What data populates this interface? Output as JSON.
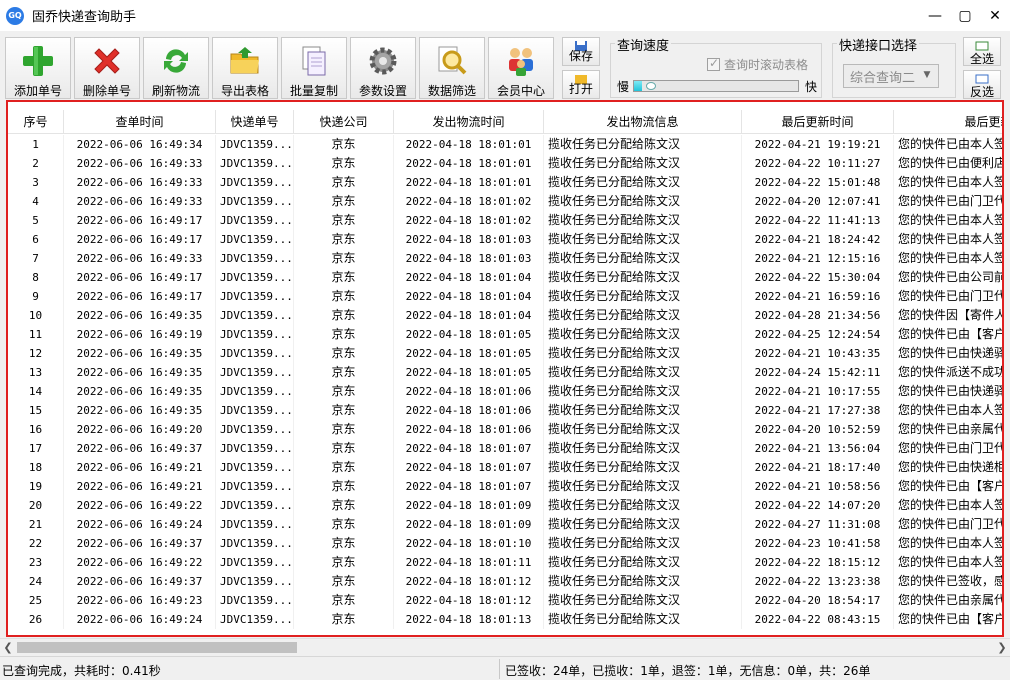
{
  "window": {
    "title": "固乔快递查询助手",
    "icon_text": "GQ"
  },
  "toolbar": {
    "buttons": [
      {
        "label": "添加单号",
        "icon": "plus-icon"
      },
      {
        "label": "删除单号",
        "icon": "delete-x-icon"
      },
      {
        "label": "刷新物流",
        "icon": "refresh-icon"
      },
      {
        "label": "导出表格",
        "icon": "folder-export-icon"
      },
      {
        "label": "批量复制",
        "icon": "copy-icon"
      },
      {
        "label": "参数设置",
        "icon": "gear-icon"
      },
      {
        "label": "数据筛选",
        "icon": "search-filter-icon"
      },
      {
        "label": "会员中心",
        "icon": "users-icon"
      }
    ],
    "save_label": "保存",
    "open_label": "打开",
    "speed_group_title": "查询速度",
    "scroll_checkbox_label": "查询时滚动表格",
    "scroll_checkbox_checked": true,
    "speed_slow": "慢",
    "speed_fast": "快",
    "speed_level": 0.05,
    "api_group_title": "快递接口选择",
    "api_selected": "综合查询二",
    "select_all_label": "全选",
    "invert_label": "反选"
  },
  "grid": {
    "columns": [
      "序号",
      "查单时间",
      "快递单号",
      "快递公司",
      "发出物流时间",
      "发出物流信息",
      "最后更新时间",
      "最后更新物流"
    ],
    "rows": [
      [
        "1",
        "2022-06-06 16:49:34",
        "JDVC1359...",
        "京东",
        "2022-04-18 18:01:01",
        "揽收任务已分配给陈文汉",
        "2022-04-21 19:19:21",
        "您的快件已由本人签"
      ],
      [
        "2",
        "2022-06-06 16:49:33",
        "JDVC1359...",
        "京东",
        "2022-04-18 18:01:01",
        "揽收任务已分配给陈文汉",
        "2022-04-22 10:11:27",
        "您的快件已由便利店"
      ],
      [
        "3",
        "2022-06-06 16:49:33",
        "JDVC1359...",
        "京东",
        "2022-04-18 18:01:01",
        "揽收任务已分配给陈文汉",
        "2022-04-22 15:01:48",
        "您的快件已由本人签"
      ],
      [
        "4",
        "2022-06-06 16:49:33",
        "JDVC1359...",
        "京东",
        "2022-04-18 18:01:02",
        "揽收任务已分配给陈文汉",
        "2022-04-20 12:07:41",
        "您的快件已由门卫代"
      ],
      [
        "5",
        "2022-06-06 16:49:17",
        "JDVC1359...",
        "京东",
        "2022-04-18 18:01:02",
        "揽收任务已分配给陈文汉",
        "2022-04-22 11:41:13",
        "您的快件已由本人签"
      ],
      [
        "6",
        "2022-06-06 16:49:17",
        "JDVC1359...",
        "京东",
        "2022-04-18 18:01:03",
        "揽收任务已分配给陈文汉",
        "2022-04-21 18:24:42",
        "您的快件已由本人签"
      ],
      [
        "7",
        "2022-06-06 16:49:33",
        "JDVC1359...",
        "京东",
        "2022-04-18 18:01:03",
        "揽收任务已分配给陈文汉",
        "2022-04-21 12:15:16",
        "您的快件已由本人签"
      ],
      [
        "8",
        "2022-06-06 16:49:17",
        "JDVC1359...",
        "京东",
        "2022-04-18 18:01:04",
        "揽收任务已分配给陈文汉",
        "2022-04-22 15:30:04",
        "您的快件已由公司前"
      ],
      [
        "9",
        "2022-06-06 16:49:17",
        "JDVC1359...",
        "京东",
        "2022-04-18 18:01:04",
        "揽收任务已分配给陈文汉",
        "2022-04-21 16:59:16",
        "您的快件已由门卫代"
      ],
      [
        "10",
        "2022-06-06 16:49:35",
        "JDVC1359...",
        "京东",
        "2022-04-18 18:01:04",
        "揽收任务已分配给陈文汉",
        "2022-04-28 21:34:56",
        "您的快件因【寄件人"
      ],
      [
        "11",
        "2022-06-06 16:49:19",
        "JDVC1359...",
        "京东",
        "2022-04-18 18:01:05",
        "揽收任务已分配给陈文汉",
        "2022-04-25 12:24:54",
        "您的快件已由【客户"
      ],
      [
        "12",
        "2022-06-06 16:49:35",
        "JDVC1359...",
        "京东",
        "2022-04-18 18:01:05",
        "揽收任务已分配给陈文汉",
        "2022-04-21 10:43:35",
        "您的快件已由快递驿"
      ],
      [
        "13",
        "2022-06-06 16:49:35",
        "JDVC1359...",
        "京东",
        "2022-04-18 18:01:05",
        "揽收任务已分配给陈文汉",
        "2022-04-24 15:42:11",
        "您的快件派送不成功"
      ],
      [
        "14",
        "2022-06-06 16:49:35",
        "JDVC1359...",
        "京东",
        "2022-04-18 18:01:06",
        "揽收任务已分配给陈文汉",
        "2022-04-21 10:17:55",
        "您的快件已由快递驿"
      ],
      [
        "15",
        "2022-06-06 16:49:35",
        "JDVC1359...",
        "京东",
        "2022-04-18 18:01:06",
        "揽收任务已分配给陈文汉",
        "2022-04-21 17:27:38",
        "您的快件已由本人签"
      ],
      [
        "16",
        "2022-06-06 16:49:20",
        "JDVC1359...",
        "京东",
        "2022-04-18 18:01:06",
        "揽收任务已分配给陈文汉",
        "2022-04-20 10:52:59",
        "您的快件已由亲属代"
      ],
      [
        "17",
        "2022-06-06 16:49:37",
        "JDVC1359...",
        "京东",
        "2022-04-18 18:01:07",
        "揽收任务已分配给陈文汉",
        "2022-04-21 13:56:04",
        "您的快件已由门卫代"
      ],
      [
        "18",
        "2022-06-06 16:49:21",
        "JDVC1359...",
        "京东",
        "2022-04-18 18:01:07",
        "揽收任务已分配给陈文汉",
        "2022-04-21 18:17:40",
        "您的快件已由快递柜"
      ],
      [
        "19",
        "2022-06-06 16:49:21",
        "JDVC1359...",
        "京东",
        "2022-04-18 18:01:07",
        "揽收任务已分配给陈文汉",
        "2022-04-21 10:58:56",
        "您的快件已由【客户"
      ],
      [
        "20",
        "2022-06-06 16:49:22",
        "JDVC1359...",
        "京东",
        "2022-04-18 18:01:09",
        "揽收任务已分配给陈文汉",
        "2022-04-22 14:07:20",
        "您的快件已由本人签"
      ],
      [
        "21",
        "2022-06-06 16:49:24",
        "JDVC1359...",
        "京东",
        "2022-04-18 18:01:09",
        "揽收任务已分配给陈文汉",
        "2022-04-27 11:31:08",
        "您的快件已由门卫代"
      ],
      [
        "22",
        "2022-06-06 16:49:37",
        "JDVC1359...",
        "京东",
        "2022-04-18 18:01:10",
        "揽收任务已分配给陈文汉",
        "2022-04-23 10:41:58",
        "您的快件已由本人签"
      ],
      [
        "23",
        "2022-06-06 16:49:22",
        "JDVC1359...",
        "京东",
        "2022-04-18 18:01:11",
        "揽收任务已分配给陈文汉",
        "2022-04-22 18:15:12",
        "您的快件已由本人签"
      ],
      [
        "24",
        "2022-06-06 16:49:37",
        "JDVC1359...",
        "京东",
        "2022-04-18 18:01:12",
        "揽收任务已分配给陈文汉",
        "2022-04-22 13:23:38",
        "您的快件已签收，感"
      ],
      [
        "25",
        "2022-06-06 16:49:23",
        "JDVC1359...",
        "京东",
        "2022-04-18 18:01:12",
        "揽收任务已分配给陈文汉",
        "2022-04-20 18:54:17",
        "您的快件已由亲属代"
      ],
      [
        "26",
        "2022-06-06 16:49:24",
        "JDVC1359...",
        "京东",
        "2022-04-18 18:01:13",
        "揽收任务已分配给陈文汉",
        "2022-04-22 08:43:15",
        "您的快件已由【客户"
      ]
    ]
  },
  "status": {
    "left": "已查询完成，共耗时：0.41秒",
    "right": "已签收：24单，已揽收：1单，退签：1单，无信息：0单，共：26单"
  },
  "colors": {
    "highlight_border": "#e02020",
    "progress_fill": "#21c4da"
  }
}
